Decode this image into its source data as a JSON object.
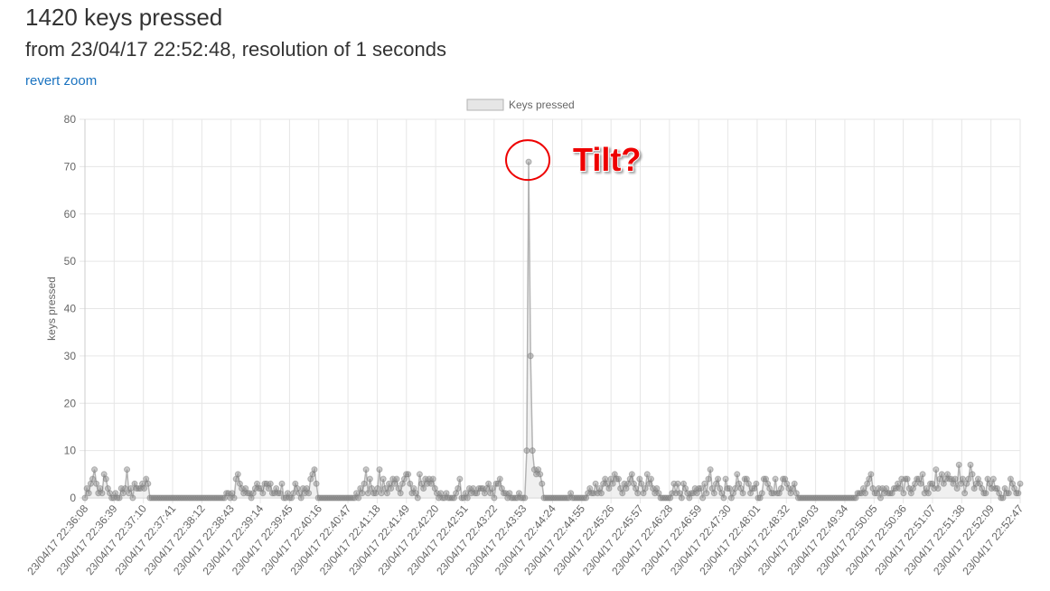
{
  "header": {
    "title": "1420 keys pressed",
    "subtitle": "from 23/04/17 22:52:48, resolution of 1 seconds",
    "revert_zoom": "revert zoom"
  },
  "annotation": {
    "text": "Tilt?"
  },
  "colors": {
    "link": "#1a73c0",
    "annotation": "#ee0000",
    "series_fill": "#e6e6e6",
    "series_line": "#b3b3b3",
    "point": "#888888",
    "grid": "#e6e6e6"
  },
  "chart_data": {
    "type": "line",
    "legend": {
      "position": "top",
      "labels": [
        "Keys pressed"
      ]
    },
    "ylabel": "keys pressed",
    "xlabel": "",
    "ylim": [
      0,
      80
    ],
    "yticks": [
      0,
      10,
      20,
      30,
      40,
      50,
      60,
      70,
      80
    ],
    "grid": true,
    "x_tick_labels": [
      "23/04/17 22:36:08",
      "23/04/17 22:36:39",
      "23/04/17 22:37:10",
      "23/04/17 22:37:41",
      "23/04/17 22:38:12",
      "23/04/17 22:38:43",
      "23/04/17 22:39:14",
      "23/04/17 22:39:45",
      "23/04/17 22:40:16",
      "23/04/17 22:40:47",
      "23/04/17 22:41:18",
      "23/04/17 22:41:49",
      "23/04/17 22:42:20",
      "23/04/17 22:42:51",
      "23/04/17 22:43:22",
      "23/04/17 22:43:53",
      "23/04/17 22:44:24",
      "23/04/17 22:44:55",
      "23/04/17 22:45:26",
      "23/04/17 22:45:57",
      "23/04/17 22:46:28",
      "23/04/17 22:46:59",
      "23/04/17 22:47:30",
      "23/04/17 22:48:01",
      "23/04/17 22:48:32",
      "23/04/17 22:49:03",
      "23/04/17 22:49:34",
      "23/04/17 22:50:05",
      "23/04/17 22:50:36",
      "23/04/17 22:51:07",
      "23/04/17 22:51:38",
      "23/04/17 22:52:09",
      "23/04/17 22:52:47"
    ],
    "series": [
      {
        "name": "Keys pressed",
        "values": [
          0,
          2,
          1,
          3,
          4,
          6,
          3,
          1,
          2,
          1,
          5,
          4,
          2,
          1,
          0,
          0,
          1,
          0,
          0,
          2,
          1,
          2,
          6,
          1,
          2,
          0,
          3,
          2,
          2,
          2,
          3,
          2,
          4,
          3,
          0,
          0,
          0,
          0,
          0,
          0,
          0,
          0,
          0,
          0,
          0,
          0,
          0,
          0,
          0,
          0,
          0,
          0,
          0,
          0,
          0,
          0,
          0,
          0,
          0,
          0,
          0,
          0,
          0,
          0,
          0,
          0,
          0,
          0,
          0,
          0,
          0,
          0,
          0,
          0,
          1,
          1,
          0,
          1,
          0,
          4,
          5,
          3,
          2,
          1,
          2,
          1,
          1,
          0,
          1,
          2,
          3,
          2,
          2,
          1,
          3,
          3,
          2,
          3,
          1,
          1,
          2,
          1,
          1,
          3,
          0,
          0,
          1,
          0,
          0,
          1,
          3,
          2,
          1,
          0,
          2,
          1,
          2,
          1,
          4,
          5,
          6,
          3,
          0,
          0,
          0,
          0,
          0,
          0,
          0,
          0,
          0,
          0,
          0,
          0,
          0,
          0,
          0,
          0,
          0,
          0,
          0,
          0,
          1,
          0,
          2,
          1,
          3,
          6,
          1,
          4,
          2,
          1,
          1,
          2,
          6,
          1,
          4,
          2,
          1,
          3,
          2,
          4,
          3,
          4,
          2,
          1,
          3,
          4,
          5,
          5,
          3,
          1,
          2,
          1,
          0,
          5,
          3,
          2,
          4,
          3,
          4,
          3,
          4,
          2,
          1,
          0,
          1,
          0,
          0,
          1,
          0,
          0,
          0,
          0,
          1,
          2,
          4,
          0,
          0,
          1,
          0,
          2,
          1,
          2,
          1,
          1,
          2,
          2,
          2,
          1,
          2,
          3,
          1,
          2,
          0,
          3,
          3,
          4,
          2,
          1,
          1,
          0,
          1,
          0,
          0,
          0,
          0,
          1,
          0,
          0,
          0,
          10,
          71,
          30,
          10,
          6,
          5,
          6,
          5,
          3,
          0,
          0,
          0,
          0,
          0,
          0,
          0,
          0,
          0,
          0,
          0,
          0,
          0,
          0,
          1,
          0,
          0,
          0,
          0,
          0,
          0,
          0,
          0,
          1,
          2,
          1,
          1,
          3,
          1,
          2,
          1,
          3,
          4,
          3,
          2,
          4,
          3,
          5,
          4,
          4,
          2,
          1,
          3,
          2,
          3,
          4,
          5,
          3,
          2,
          1,
          4,
          3,
          1,
          2,
          5,
          3,
          4,
          2,
          1,
          2,
          1,
          0,
          0,
          0,
          0,
          0,
          0,
          1,
          3,
          1,
          3,
          1,
          0,
          3,
          2,
          1,
          0,
          1,
          1,
          2,
          1,
          2,
          2,
          0,
          3,
          1,
          4,
          6,
          2,
          1,
          3,
          4,
          2,
          1,
          0,
          4,
          2,
          2,
          0,
          1,
          2,
          5,
          3,
          2,
          1,
          4,
          4,
          3,
          1,
          2,
          2,
          3,
          0,
          0,
          1,
          4,
          4,
          3,
          2,
          1,
          1,
          4,
          1,
          1,
          2,
          4,
          4,
          3,
          2,
          1,
          2,
          3,
          1,
          0,
          0,
          0,
          0,
          0,
          0,
          0,
          0,
          0,
          0,
          0,
          0,
          0,
          0,
          0,
          0,
          0,
          0,
          0,
          0,
          0,
          0,
          0,
          0,
          0,
          0,
          0,
          0,
          0,
          0,
          0,
          1,
          1,
          1,
          2,
          1,
          3,
          4,
          5,
          2,
          1,
          1,
          2,
          0,
          2,
          1,
          2,
          1,
          1,
          1,
          2,
          2,
          3,
          2,
          4,
          1,
          4,
          4,
          2,
          1,
          2,
          3,
          4,
          4,
          3,
          5,
          1,
          2,
          1,
          3,
          3,
          2,
          6,
          2,
          4,
          5,
          3,
          4,
          5,
          4,
          4,
          3,
          4,
          2,
          7,
          3,
          4,
          1,
          3,
          4,
          7,
          5,
          2,
          3,
          4,
          3,
          2,
          1,
          1,
          4,
          3,
          2,
          4,
          2,
          2,
          1,
          0,
          0,
          2,
          1,
          1,
          4,
          3,
          2,
          1,
          1,
          3
        ]
      }
    ]
  }
}
